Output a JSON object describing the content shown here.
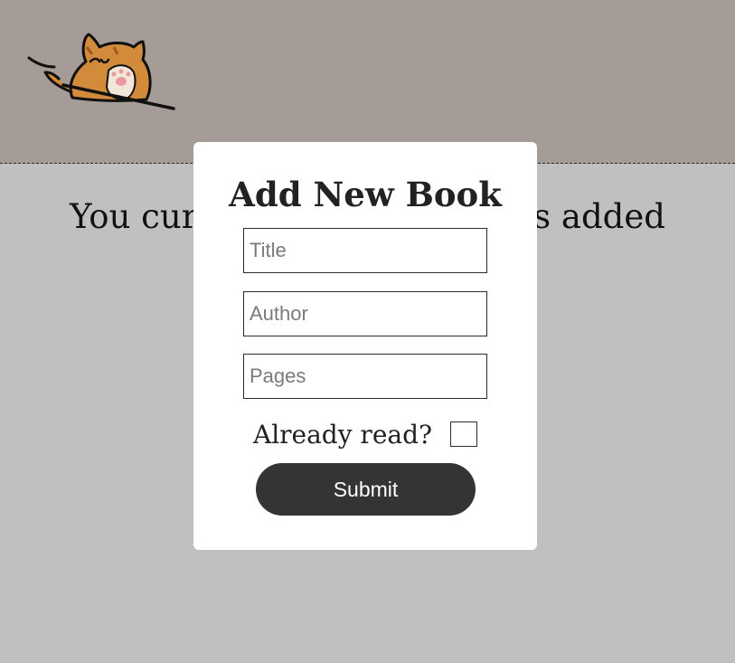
{
  "header": {
    "logo": "peeking-cat"
  },
  "main": {
    "empty_message": "You currently have no books added"
  },
  "modal": {
    "title": "Add New Book",
    "fields": {
      "title_placeholder": "Title",
      "author_placeholder": "Author",
      "pages_placeholder": "Pages"
    },
    "read_label": "Already read?",
    "read_checked": false,
    "submit_label": "Submit"
  },
  "colors": {
    "header_bg": "#a69c97",
    "page_bg": "#c0c0c0",
    "modal_bg": "#ffffff",
    "button_bg": "#343434"
  }
}
